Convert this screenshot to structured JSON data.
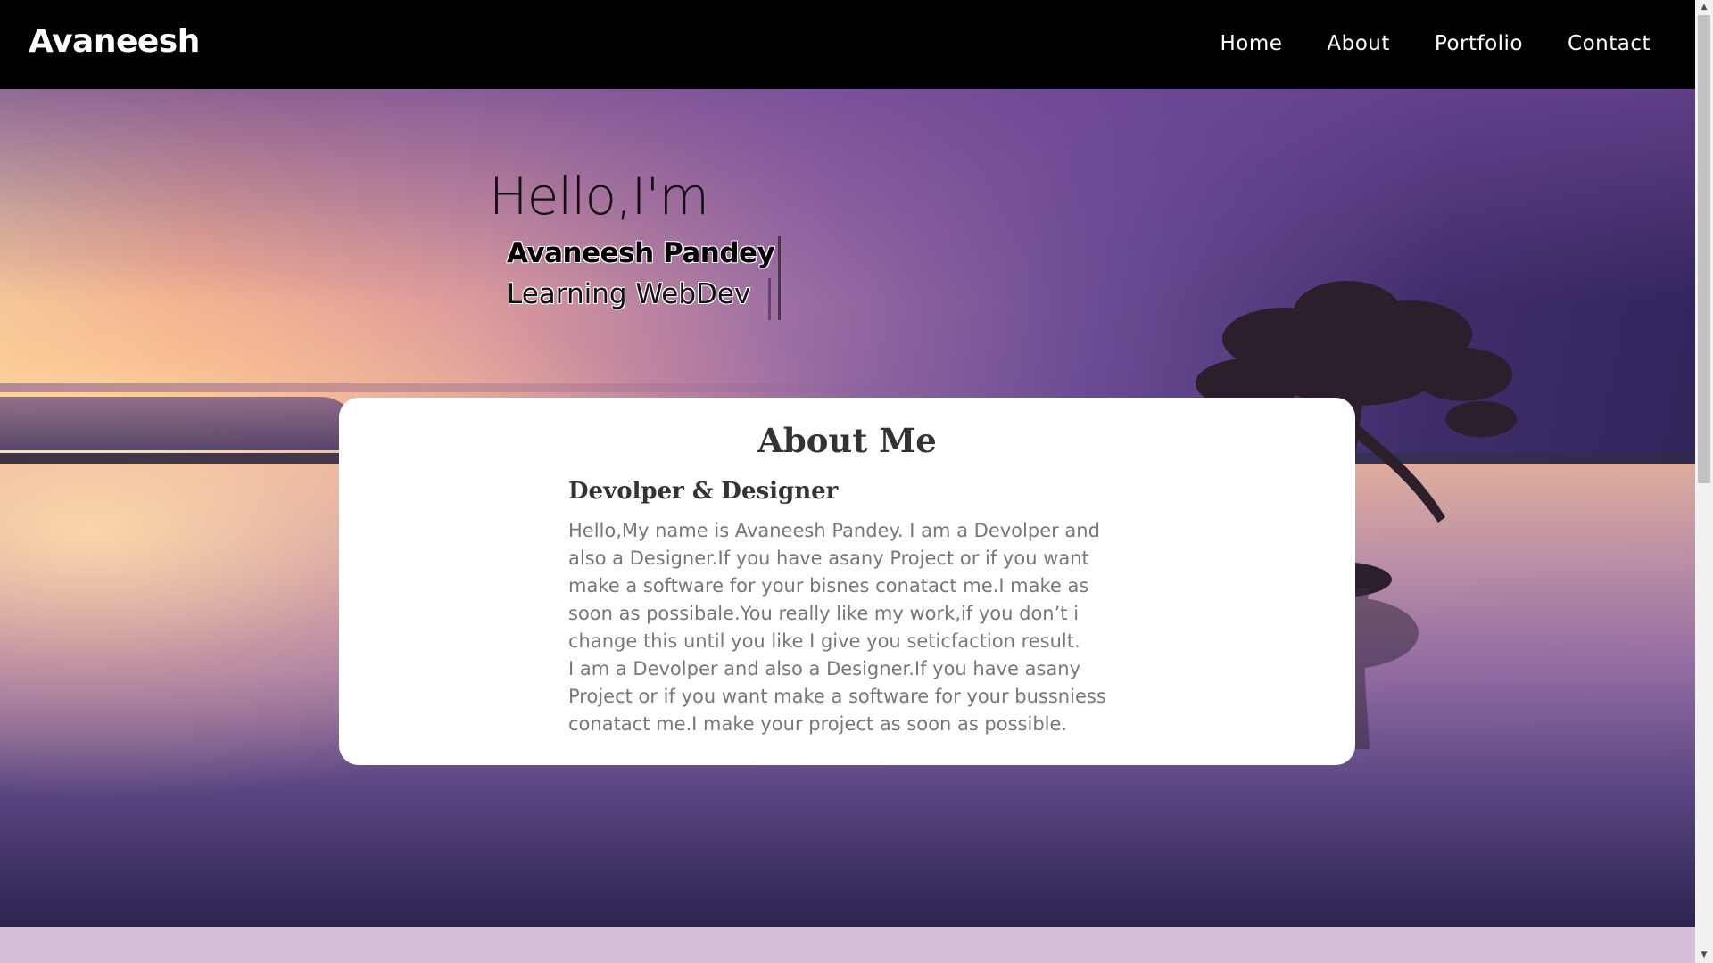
{
  "header": {
    "brand": "Avaneesh",
    "nav": [
      {
        "label": "Home"
      },
      {
        "label": "About"
      },
      {
        "label": "Portfolio"
      },
      {
        "label": "Contact"
      }
    ]
  },
  "hero": {
    "greeting": "Hello,I'm",
    "typed_name": "Avaneesh Pandey",
    "typed_sub": "Learning WebDev"
  },
  "about": {
    "title": "About Me",
    "subtitle": "Devolper & Designer",
    "paragraph_1": "Hello,My name is Avaneesh Pandey. I am a Devolper and also a Designer.If you have asany Project or if you want make a software for your bisnes conatact me.I make as soon as possibale.You really like my work,if you don’t i change this until you like I give you seticfaction result.",
    "paragraph_2": "I am a Devolper and also a Designer.If you have asany Project or if you want make a software for your bussniess conatact me.I make your project as soon as possible."
  },
  "scrollbar": {
    "up_icon": "triangle-up-icon",
    "down_icon": "triangle-down-icon"
  },
  "colors": {
    "navbar": "#000000",
    "card": "#ffffff",
    "bottom_band": "#d7bfd9"
  }
}
